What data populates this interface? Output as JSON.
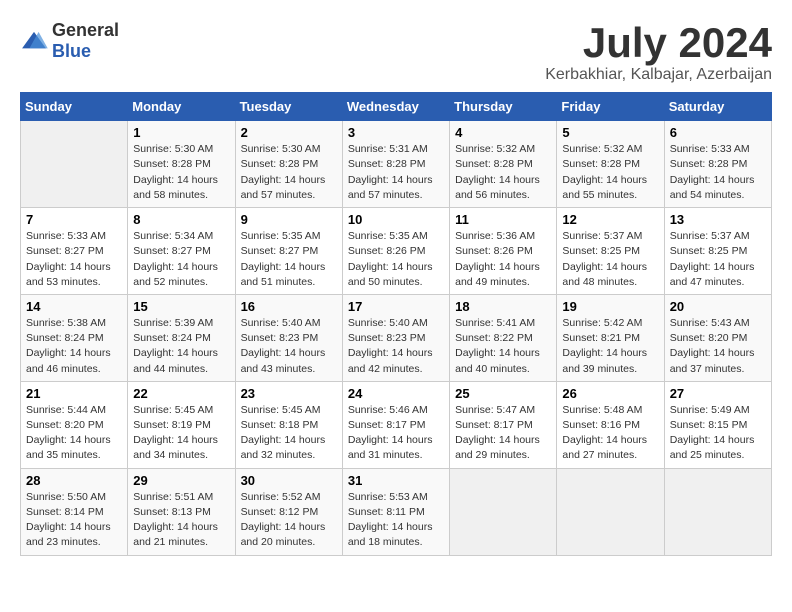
{
  "logo": {
    "text1": "General",
    "text2": "Blue"
  },
  "title": "July 2024",
  "location": "Kerbakhiar, Kalbajar, Azerbaijan",
  "days_header": [
    "Sunday",
    "Monday",
    "Tuesday",
    "Wednesday",
    "Thursday",
    "Friday",
    "Saturday"
  ],
  "weeks": [
    [
      {
        "day": "",
        "content": ""
      },
      {
        "day": "1",
        "content": "Sunrise: 5:30 AM\nSunset: 8:28 PM\nDaylight: 14 hours\nand 58 minutes."
      },
      {
        "day": "2",
        "content": "Sunrise: 5:30 AM\nSunset: 8:28 PM\nDaylight: 14 hours\nand 57 minutes."
      },
      {
        "day": "3",
        "content": "Sunrise: 5:31 AM\nSunset: 8:28 PM\nDaylight: 14 hours\nand 57 minutes."
      },
      {
        "day": "4",
        "content": "Sunrise: 5:32 AM\nSunset: 8:28 PM\nDaylight: 14 hours\nand 56 minutes."
      },
      {
        "day": "5",
        "content": "Sunrise: 5:32 AM\nSunset: 8:28 PM\nDaylight: 14 hours\nand 55 minutes."
      },
      {
        "day": "6",
        "content": "Sunrise: 5:33 AM\nSunset: 8:28 PM\nDaylight: 14 hours\nand 54 minutes."
      }
    ],
    [
      {
        "day": "7",
        "content": "Sunrise: 5:33 AM\nSunset: 8:27 PM\nDaylight: 14 hours\nand 53 minutes."
      },
      {
        "day": "8",
        "content": "Sunrise: 5:34 AM\nSunset: 8:27 PM\nDaylight: 14 hours\nand 52 minutes."
      },
      {
        "day": "9",
        "content": "Sunrise: 5:35 AM\nSunset: 8:27 PM\nDaylight: 14 hours\nand 51 minutes."
      },
      {
        "day": "10",
        "content": "Sunrise: 5:35 AM\nSunset: 8:26 PM\nDaylight: 14 hours\nand 50 minutes."
      },
      {
        "day": "11",
        "content": "Sunrise: 5:36 AM\nSunset: 8:26 PM\nDaylight: 14 hours\nand 49 minutes."
      },
      {
        "day": "12",
        "content": "Sunrise: 5:37 AM\nSunset: 8:25 PM\nDaylight: 14 hours\nand 48 minutes."
      },
      {
        "day": "13",
        "content": "Sunrise: 5:37 AM\nSunset: 8:25 PM\nDaylight: 14 hours\nand 47 minutes."
      }
    ],
    [
      {
        "day": "14",
        "content": "Sunrise: 5:38 AM\nSunset: 8:24 PM\nDaylight: 14 hours\nand 46 minutes."
      },
      {
        "day": "15",
        "content": "Sunrise: 5:39 AM\nSunset: 8:24 PM\nDaylight: 14 hours\nand 44 minutes."
      },
      {
        "day": "16",
        "content": "Sunrise: 5:40 AM\nSunset: 8:23 PM\nDaylight: 14 hours\nand 43 minutes."
      },
      {
        "day": "17",
        "content": "Sunrise: 5:40 AM\nSunset: 8:23 PM\nDaylight: 14 hours\nand 42 minutes."
      },
      {
        "day": "18",
        "content": "Sunrise: 5:41 AM\nSunset: 8:22 PM\nDaylight: 14 hours\nand 40 minutes."
      },
      {
        "day": "19",
        "content": "Sunrise: 5:42 AM\nSunset: 8:21 PM\nDaylight: 14 hours\nand 39 minutes."
      },
      {
        "day": "20",
        "content": "Sunrise: 5:43 AM\nSunset: 8:20 PM\nDaylight: 14 hours\nand 37 minutes."
      }
    ],
    [
      {
        "day": "21",
        "content": "Sunrise: 5:44 AM\nSunset: 8:20 PM\nDaylight: 14 hours\nand 35 minutes."
      },
      {
        "day": "22",
        "content": "Sunrise: 5:45 AM\nSunset: 8:19 PM\nDaylight: 14 hours\nand 34 minutes."
      },
      {
        "day": "23",
        "content": "Sunrise: 5:45 AM\nSunset: 8:18 PM\nDaylight: 14 hours\nand 32 minutes."
      },
      {
        "day": "24",
        "content": "Sunrise: 5:46 AM\nSunset: 8:17 PM\nDaylight: 14 hours\nand 31 minutes."
      },
      {
        "day": "25",
        "content": "Sunrise: 5:47 AM\nSunset: 8:17 PM\nDaylight: 14 hours\nand 29 minutes."
      },
      {
        "day": "26",
        "content": "Sunrise: 5:48 AM\nSunset: 8:16 PM\nDaylight: 14 hours\nand 27 minutes."
      },
      {
        "day": "27",
        "content": "Sunrise: 5:49 AM\nSunset: 8:15 PM\nDaylight: 14 hours\nand 25 minutes."
      }
    ],
    [
      {
        "day": "28",
        "content": "Sunrise: 5:50 AM\nSunset: 8:14 PM\nDaylight: 14 hours\nand 23 minutes."
      },
      {
        "day": "29",
        "content": "Sunrise: 5:51 AM\nSunset: 8:13 PM\nDaylight: 14 hours\nand 21 minutes."
      },
      {
        "day": "30",
        "content": "Sunrise: 5:52 AM\nSunset: 8:12 PM\nDaylight: 14 hours\nand 20 minutes."
      },
      {
        "day": "31",
        "content": "Sunrise: 5:53 AM\nSunset: 8:11 PM\nDaylight: 14 hours\nand 18 minutes."
      },
      {
        "day": "",
        "content": ""
      },
      {
        "day": "",
        "content": ""
      },
      {
        "day": "",
        "content": ""
      }
    ]
  ]
}
